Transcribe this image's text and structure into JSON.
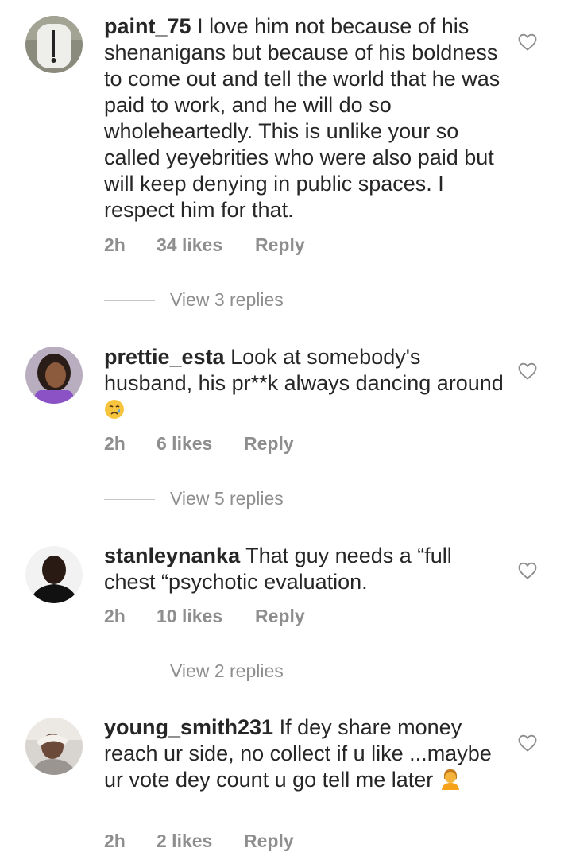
{
  "comments": [
    {
      "username": "paint_75",
      "text": "I love him not because of his shenanigans but because of his boldness to come out and tell the world that he was paid to work, and he will do so wholeheartedly. This is unlike your so called yeyebrities who were also paid but will keep denying in public spaces. I respect him for that.",
      "time": "2h",
      "likes": "34 likes",
      "reply": "Reply",
      "view_replies": "View 3 replies"
    },
    {
      "username": "prettie_esta",
      "text": "Look at somebody's husband, his pr**k always dancing around",
      "emoji": "crying-face",
      "time": "2h",
      "likes": "6 likes",
      "reply": "Reply",
      "view_replies": "View 5 replies"
    },
    {
      "username": "stanleynanka",
      "text": "That guy needs a “full chest “psychotic evaluation.",
      "time": "2h",
      "likes": "10 likes",
      "reply": "Reply",
      "view_replies": "View 2 replies"
    },
    {
      "username": "young_smith231",
      "text": "If dey share money reach ur side, no collect if u like ...maybe ur vote dey count u go tell me later",
      "emoji": "person-facepalming",
      "time": "2h",
      "likes": "2 likes",
      "reply": "Reply"
    }
  ],
  "icons": {
    "like": "heart-outline-icon"
  },
  "colors": {
    "text": "#262626",
    "meta": "#8e8e8e",
    "divider": "#c7c7c7"
  }
}
